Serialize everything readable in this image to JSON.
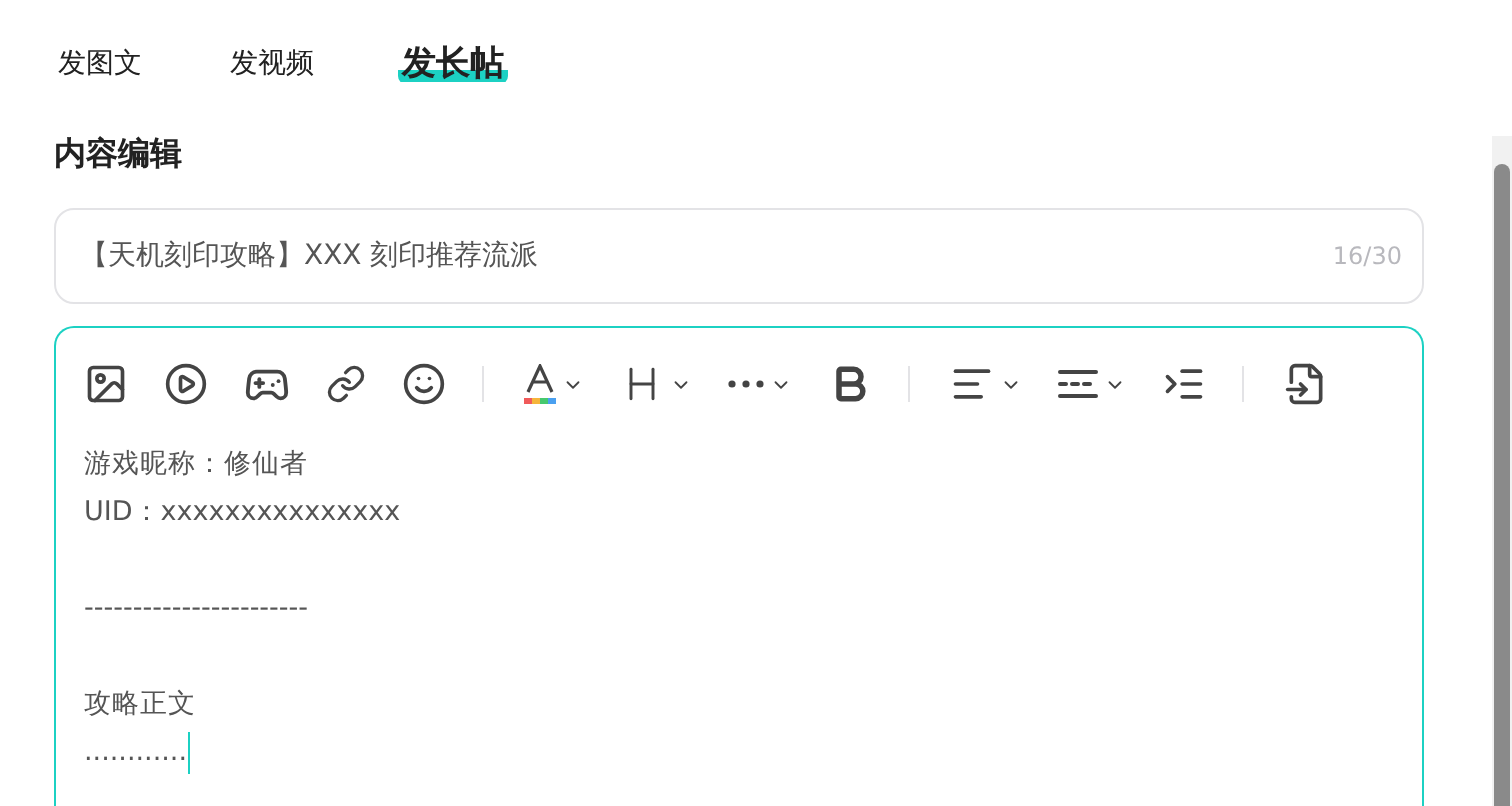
{
  "tabs": [
    {
      "label": "发图文",
      "selected": false
    },
    {
      "label": "发视频",
      "selected": false
    },
    {
      "label": "发长帖",
      "selected": true
    }
  ],
  "section_title": "内容编辑",
  "title_field": {
    "value": "【天机刻印攻略】XXX 刻印推荐流派",
    "counter": "16/30"
  },
  "editor": {
    "lines": [
      {
        "kind": "text",
        "text": "游戏昵称：修仙者",
        "caret": false
      },
      {
        "kind": "text",
        "text": "UID：xxxxxxxxxxxxxxx",
        "caret": false
      },
      {
        "kind": "blank"
      },
      {
        "kind": "text",
        "text": "-----------------------",
        "caret": false
      },
      {
        "kind": "blank"
      },
      {
        "kind": "text",
        "text": "攻略正文",
        "caret": false
      },
      {
        "kind": "text",
        "text": "............",
        "caret": true
      }
    ]
  }
}
